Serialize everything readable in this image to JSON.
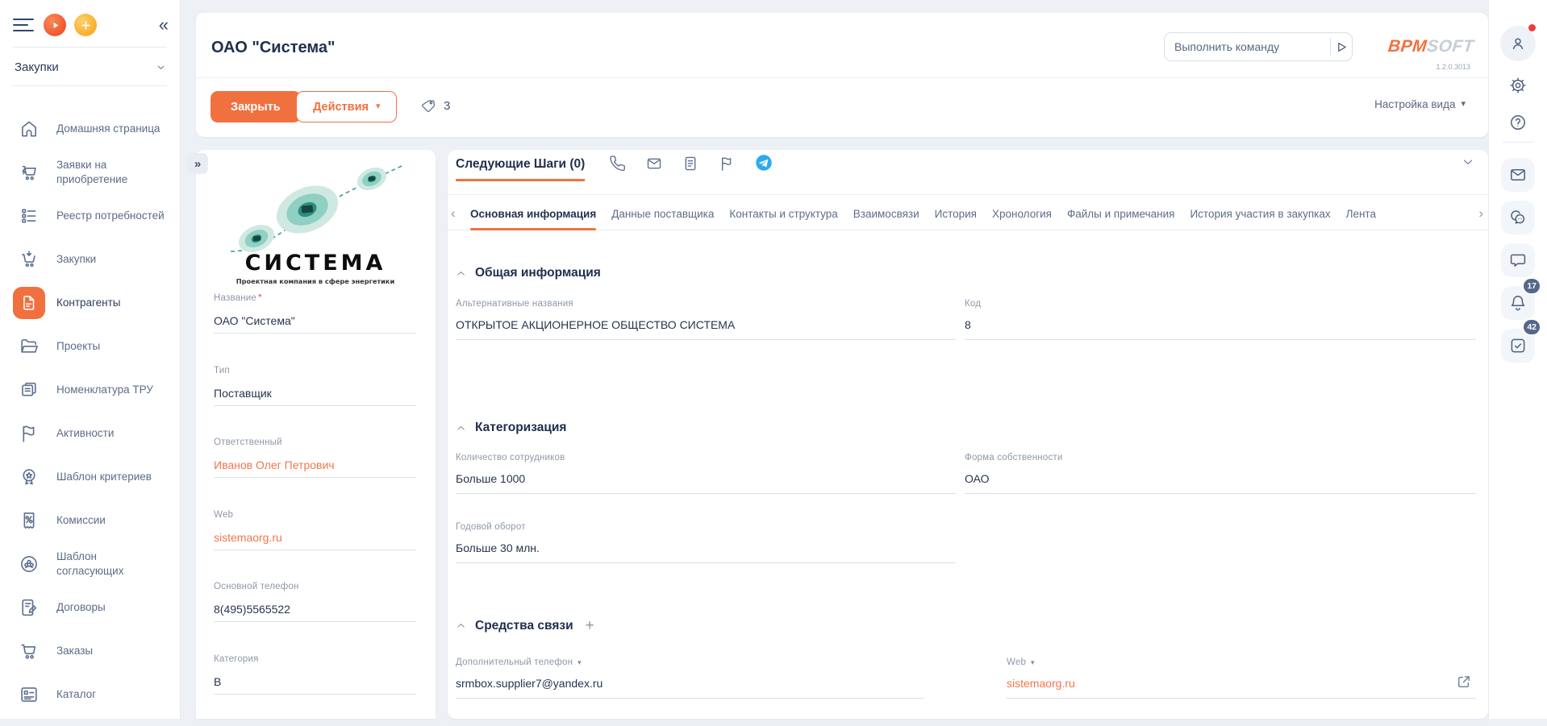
{
  "colors": {
    "accent_orange": "#f0713f",
    "link_orange": "#f2764a",
    "telegram_blue": "#2AABEE",
    "badge_slate": "#54688a",
    "notification_red": "#ec3e3e",
    "background": "#edf0f5"
  },
  "glyphs": {
    "collapse": "«",
    "expand": "»",
    "prev": "‹",
    "next": "›",
    "caret_down": "▾",
    "add": "+",
    "required": "*"
  },
  "sidebar": {
    "workspace": "Закупки",
    "items": [
      {
        "label": "Домашняя страница",
        "icon": "home"
      },
      {
        "label": "Заявки на приобретение",
        "icon": "cart-request"
      },
      {
        "label": "Реестр потребностей",
        "icon": "registry"
      },
      {
        "label": "Закупки",
        "icon": "cart-down"
      },
      {
        "label": "Контрагенты",
        "icon": "document",
        "active": true
      },
      {
        "label": "Проекты",
        "icon": "folder"
      },
      {
        "label": "Номенклатура ТРУ",
        "icon": "papers"
      },
      {
        "label": "Активности",
        "icon": "flag"
      },
      {
        "label": "Шаблон критериев",
        "icon": "award"
      },
      {
        "label": "Комиссии",
        "icon": "percent"
      },
      {
        "label": "Шаблон согласующих",
        "icon": "group"
      },
      {
        "label": "Договоры",
        "icon": "contract"
      },
      {
        "label": "Заказы",
        "icon": "cart"
      },
      {
        "label": "Каталог",
        "icon": "catalog"
      }
    ]
  },
  "header": {
    "title": "ОАО \"Система\"",
    "command_placeholder": "Выполнить команду",
    "brand_primary": "BPM",
    "brand_secondary": "SOFT",
    "version": "1.2.0.3013",
    "close_button": "Закрыть",
    "actions_button": "Действия",
    "tags_count": "3",
    "view_settings": "Настройка вида"
  },
  "profile": {
    "company_logo_title": "СИСТЕМА",
    "company_logo_tagline": "Проектная компания в сфере энергетики",
    "fields": [
      {
        "label": "Название",
        "value": "ОАО \"Система\"",
        "required": true
      },
      {
        "label": "Тип",
        "value": "Поставщик"
      },
      {
        "label": "Ответственный",
        "value": "Иванов Олег Петрович",
        "link": true
      },
      {
        "label": "Web",
        "value": "sistemaorg.ru",
        "link": true
      },
      {
        "label": "Основной телефон",
        "value": "8(495)5565522"
      },
      {
        "label": "Категория",
        "value": "В"
      }
    ]
  },
  "main": {
    "next_steps_title": "Следующие Шаги (0)",
    "tabs": [
      "Основная информация",
      "Данные поставщика",
      "Контакты и структура",
      "Взаимосвязи",
      "История",
      "Хронология",
      "Файлы и примечания",
      "История участия в закупках",
      "Лента"
    ],
    "active_tab": "Основная информация",
    "sections": {
      "general": {
        "title": "Общая информация",
        "alt_names_label": "Альтернативные названия",
        "alt_names_value": "ОТКРЫТОЕ АКЦИОНЕРНОЕ ОБЩЕСТВО СИСТЕМА",
        "code_label": "Код",
        "code_value": "8"
      },
      "categorization": {
        "title": "Категоризация",
        "employees_label": "Количество сотрудников",
        "employees_value": "Больше 1000",
        "ownership_label": "Форма собственности",
        "ownership_value": "ОАО",
        "turnover_label": "Годовой оборот",
        "turnover_value": "Больше 30 млн."
      },
      "communication": {
        "title": "Средства связи",
        "phone_label": "Дополнительный телефон",
        "phone_value": "srmbox.supplier7@yandex.ru",
        "web_label": "Web",
        "web_value": "sistemaorg.ru"
      }
    }
  },
  "rail": {
    "notifications_badge": "17",
    "tasks_badge": "42"
  }
}
